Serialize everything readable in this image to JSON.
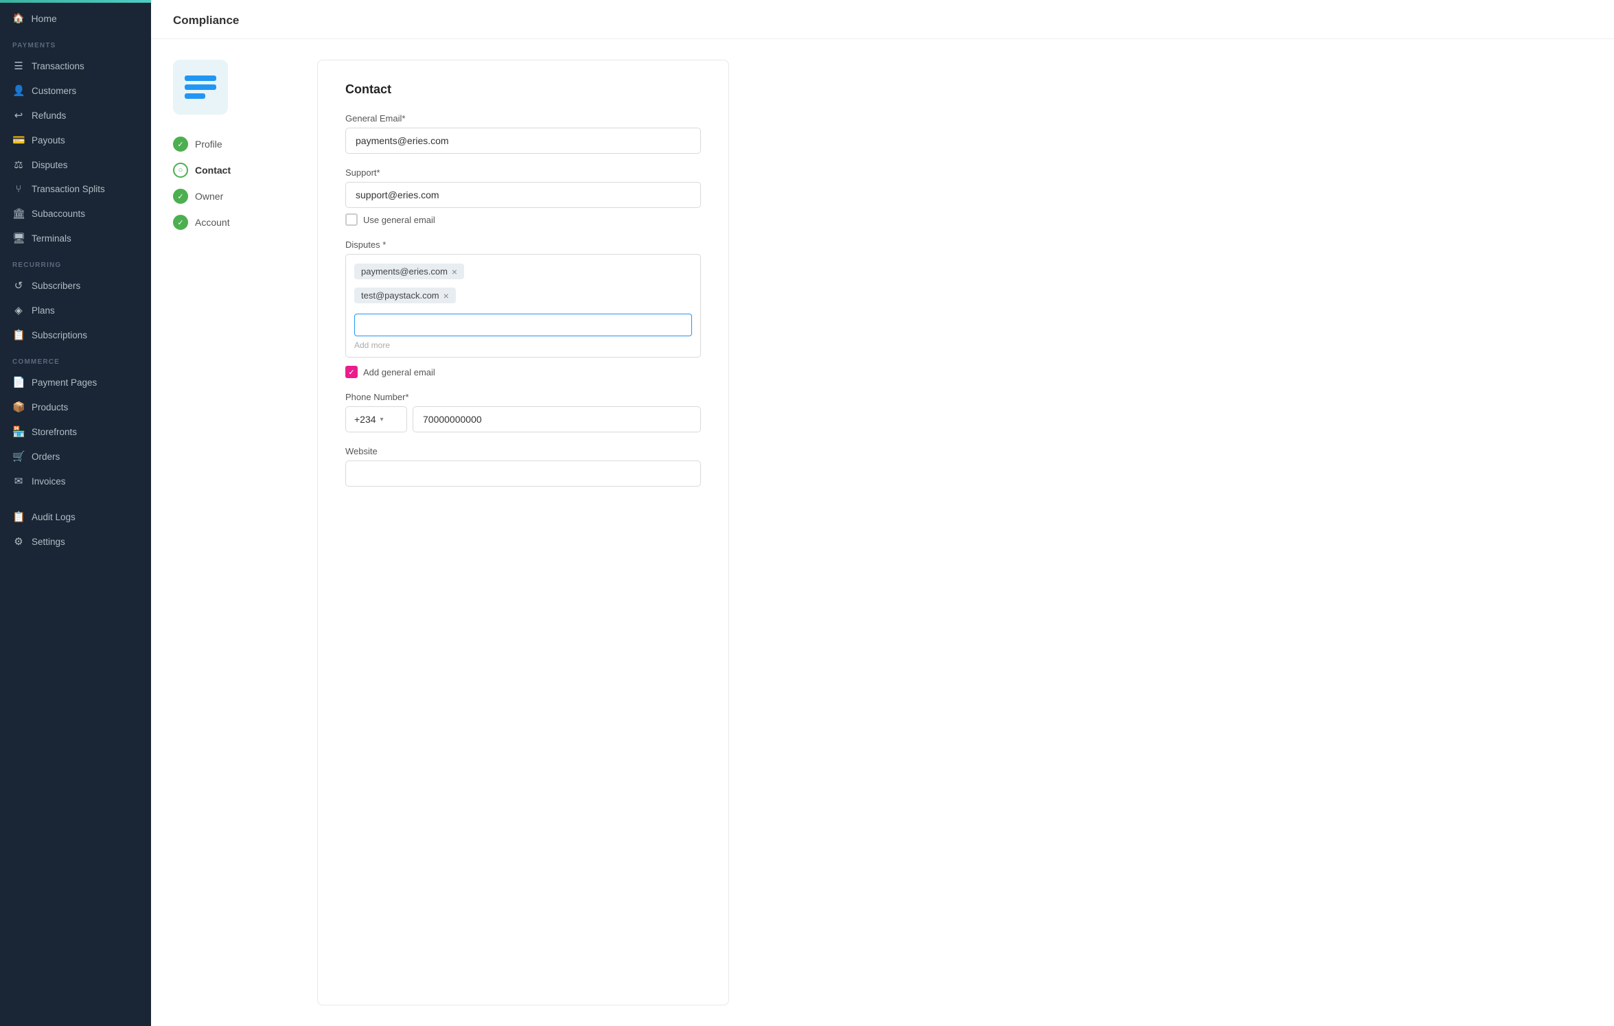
{
  "sidebar": {
    "top_bar_color": "#3bb3a0",
    "home_label": "Home",
    "sections": [
      {
        "label": "PAYMENTS",
        "items": [
          {
            "icon": "☰",
            "label": "Transactions"
          },
          {
            "icon": "👤",
            "label": "Customers"
          },
          {
            "icon": "↩",
            "label": "Refunds"
          },
          {
            "icon": "💳",
            "label": "Payouts"
          },
          {
            "icon": "⚖",
            "label": "Disputes"
          },
          {
            "icon": "⑂",
            "label": "Transaction Splits"
          },
          {
            "icon": "🏛",
            "label": "Subaccounts"
          },
          {
            "icon": "🖥",
            "label": "Terminals"
          }
        ]
      },
      {
        "label": "RECURRING",
        "items": [
          {
            "icon": "↺",
            "label": "Subscribers"
          },
          {
            "icon": "◈",
            "label": "Plans"
          },
          {
            "icon": "📋",
            "label": "Subscriptions"
          }
        ]
      },
      {
        "label": "COMMERCE",
        "items": [
          {
            "icon": "📄",
            "label": "Payment Pages"
          },
          {
            "icon": "📦",
            "label": "Products"
          },
          {
            "icon": "🏪",
            "label": "Storefronts"
          },
          {
            "icon": "🛒",
            "label": "Orders"
          },
          {
            "icon": "✉",
            "label": "Invoices"
          }
        ]
      },
      {
        "label": "",
        "items": [
          {
            "icon": "📋",
            "label": "Audit Logs"
          },
          {
            "icon": "⚙",
            "label": "Settings"
          }
        ]
      }
    ]
  },
  "page": {
    "title": "Compliance"
  },
  "steps": [
    {
      "label": "Profile",
      "state": "complete"
    },
    {
      "label": "Contact",
      "state": "active"
    },
    {
      "label": "Owner",
      "state": "complete"
    },
    {
      "label": "Account",
      "state": "complete"
    }
  ],
  "form": {
    "section_title": "Contact",
    "general_email_label": "General Email*",
    "general_email_value": "payments@eries.com",
    "support_label": "Support*",
    "support_value": "support@eries.com",
    "use_general_email_label": "Use general email",
    "disputes_label": "Disputes *",
    "dispute_tags": [
      {
        "email": "payments@eries.com"
      },
      {
        "email": "test@paystack.com"
      }
    ],
    "add_more_hint": "Add more",
    "add_general_email_label": "Add general email",
    "phone_label": "Phone Number*",
    "phone_country_code": "+234",
    "phone_number": "70000000000",
    "website_label": "Website"
  }
}
